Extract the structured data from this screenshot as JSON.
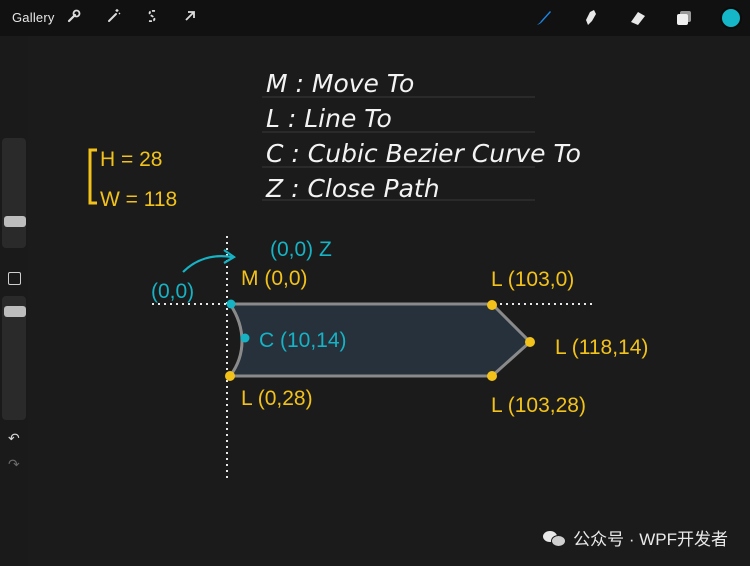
{
  "toolbar": {
    "gallery_label": "Gallery",
    "left_tools": [
      "wrench-icon",
      "magic-wand-icon",
      "selection-icon",
      "transform-arrow-icon"
    ],
    "right_tools": [
      "brush-icon",
      "smudge-icon",
      "eraser-icon",
      "layers-icon",
      "color-swatch"
    ],
    "accent_color": "#1b86e6",
    "swatch_color": "#14b6c7"
  },
  "legend_lines": [
    "M :  Move To",
    "L :  Line To",
    "C :  Cubic Bezier Curve To",
    "Z :  Close Path"
  ],
  "dims": {
    "height": "H = 28",
    "width": "W = 118"
  },
  "labels": {
    "start_top": "(0,0) Z",
    "origin_left": "(0,0)",
    "move_to": "M (0,0)",
    "curve": "C (10,14)",
    "line_top_right": "L (103,0)",
    "line_tip": "L (118,14)",
    "line_bottom_left": "L (0,28)",
    "line_bottom_right": "L (103,28)"
  },
  "colors": {
    "yellow": "#f2c21b",
    "cyan": "#16b3c4",
    "white": "#f3f3f3"
  },
  "watermark": "公众号 · WPF开发者"
}
